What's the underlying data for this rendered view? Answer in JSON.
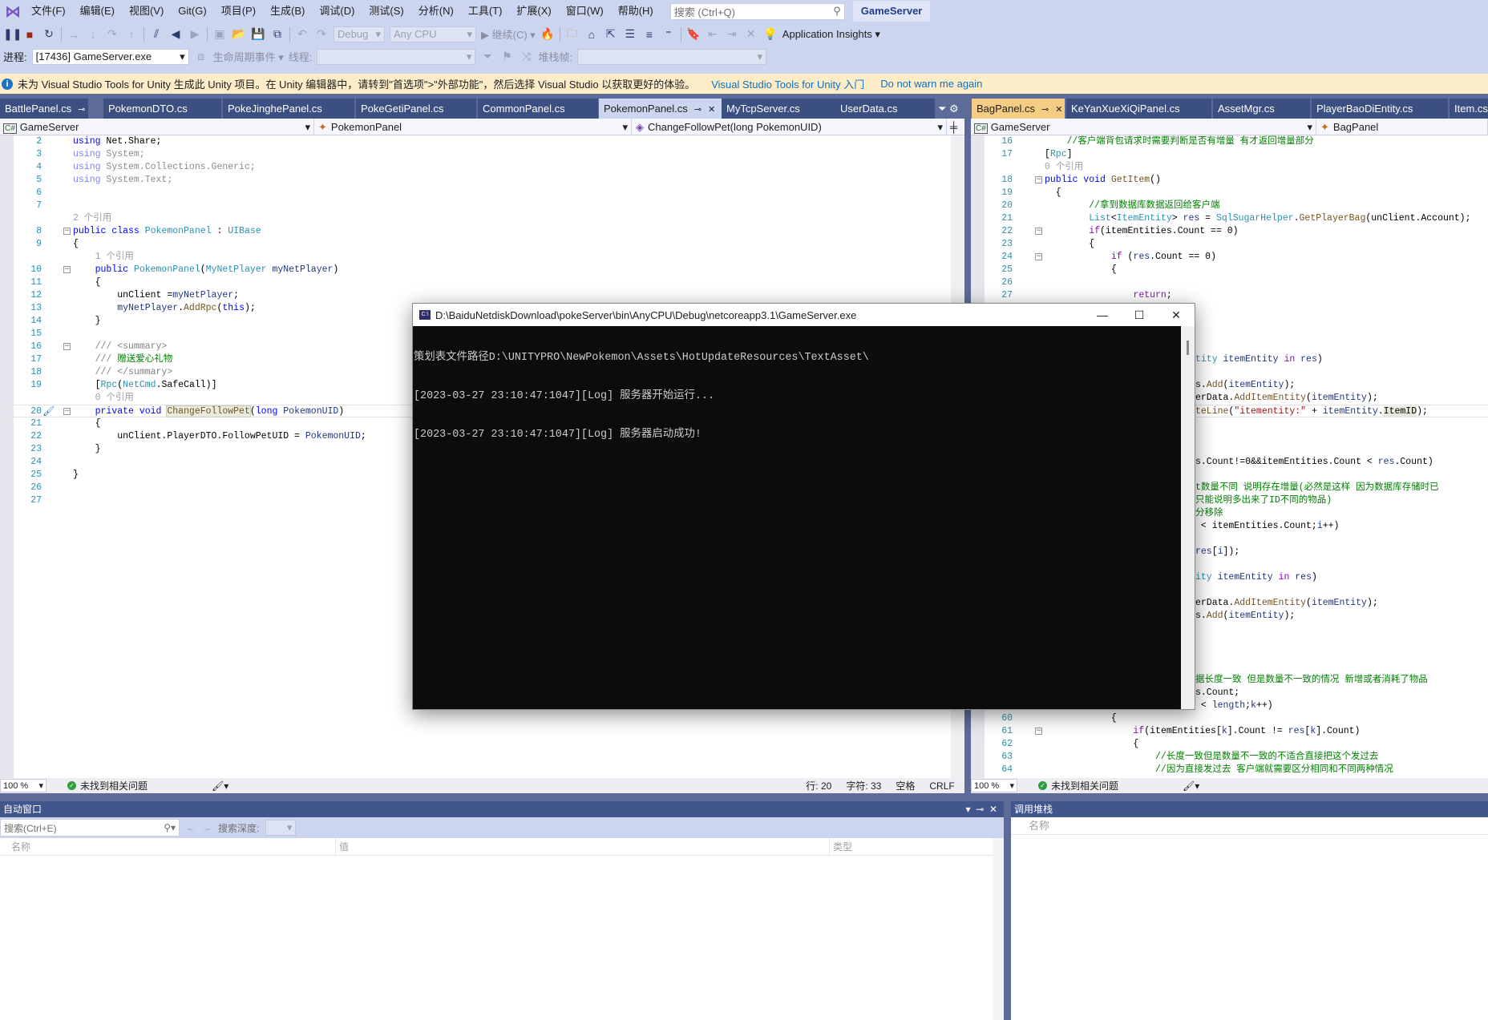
{
  "menu": [
    "文件(F)",
    "编辑(E)",
    "视图(V)",
    "Git(G)",
    "项目(P)",
    "生成(B)",
    "调试(D)",
    "测试(S)",
    "分析(N)",
    "工具(T)",
    "扩展(X)",
    "窗口(W)",
    "帮助(H)"
  ],
  "search": {
    "placeholder": "搜索 (Ctrl+Q)"
  },
  "solution_name": "GameServer",
  "toolbar1": {
    "config": "Debug",
    "platform": "Any CPU",
    "continue": "继续(C)",
    "insights": "Application Insights"
  },
  "toolbar2": {
    "process_label": "进程:",
    "process_value": "[17436] GameServer.exe",
    "lifecycle": "生命周期事件",
    "thread_label": "线程:",
    "stackframe_label": "堆栈帧:"
  },
  "infobar": {
    "message": "未为 Visual Studio Tools for Unity 生成此 Unity 项目。在 Unity 编辑器中，请转到\"首选项\">\"外部功能\"，然后选择 Visual Studio 以获取更好的体验。",
    "link1": "Visual Studio Tools for Unity 入门",
    "link2": "Do not warn me again"
  },
  "left_tabs": [
    "BattlePanel.cs",
    "PokemonDTO.cs",
    "PokeJinghePanel.cs",
    "PokeGetiPanel.cs",
    "CommonPanel.cs",
    "PokemonPanel.cs",
    "MyTcpServer.cs",
    "UserData.cs"
  ],
  "right_tabs": [
    "BagPanel.cs",
    "KeYanXueXiQiPanel.cs",
    "AssetMgr.cs",
    "PlayerBaoDiEntity.cs",
    "Item.cs"
  ],
  "left_nav": {
    "project": "GameServer",
    "class": "PokemonPanel",
    "member": "ChangeFollowPet(long PokemonUID)"
  },
  "right_nav": {
    "project": "GameServer",
    "class": "BagPanel"
  },
  "left_code": [
    {
      "n": "2",
      "t": [
        [
          "using",
          "kw"
        ],
        [
          " Net.Share;",
          "pl"
        ]
      ]
    },
    {
      "n": "3",
      "t": [
        [
          "using",
          "dimkw"
        ],
        [
          " System;",
          "dim"
        ]
      ]
    },
    {
      "n": "4",
      "t": [
        [
          "using",
          "dimkw"
        ],
        [
          " System.Collections.Generic;",
          "dim"
        ]
      ]
    },
    {
      "n": "5",
      "t": [
        [
          "using",
          "dimkw"
        ],
        [
          " System.Text;",
          "dim"
        ]
      ]
    },
    {
      "n": "6",
      "t": []
    },
    {
      "n": "7",
      "t": []
    },
    {
      "n": "",
      "t": [
        [
          "2 个引用",
          "lens"
        ]
      ]
    },
    {
      "n": "8",
      "fold": true,
      "t": [
        [
          "public class ",
          "kw"
        ],
        [
          "PokemonPanel",
          "ty"
        ],
        [
          " : ",
          "pl"
        ],
        [
          "UIBase",
          "ty"
        ]
      ]
    },
    {
      "n": "9",
      "t": [
        [
          "{",
          "pl"
        ]
      ]
    },
    {
      "n": "",
      "t": [
        [
          "    1 个引用",
          "lens"
        ]
      ]
    },
    {
      "n": "10",
      "fold": true,
      "t": [
        [
          "    public ",
          "kw"
        ],
        [
          "PokemonPanel",
          "ty"
        ],
        [
          "(",
          "pl"
        ],
        [
          "MyNetPlayer",
          "ty"
        ],
        [
          " myNetPlayer",
          "var"
        ],
        [
          ")",
          "pl"
        ]
      ]
    },
    {
      "n": "11",
      "t": [
        [
          "    {",
          "pl"
        ]
      ]
    },
    {
      "n": "12",
      "t": [
        [
          "        unClient =",
          "pl"
        ],
        [
          "myNetPlayer",
          "var"
        ],
        [
          ";",
          "pl"
        ]
      ]
    },
    {
      "n": "13",
      "t": [
        [
          "        myNetPlayer",
          "var"
        ],
        [
          ".",
          "pl"
        ],
        [
          "AddRpc",
          "fn"
        ],
        [
          "(",
          "pl"
        ],
        [
          "this",
          "kw"
        ],
        [
          ");",
          "pl"
        ]
      ]
    },
    {
      "n": "14",
      "t": [
        [
          "    }",
          "pl"
        ]
      ]
    },
    {
      "n": "15",
      "t": []
    },
    {
      "n": "16",
      "fold": true,
      "t": [
        [
          "    /// <summary>",
          "doc"
        ]
      ]
    },
    {
      "n": "17",
      "t": [
        [
          "    /// ",
          "doc"
        ],
        [
          "赠送爱心礼物",
          "cm"
        ]
      ]
    },
    {
      "n": "18",
      "t": [
        [
          "    /// </summary>",
          "doc"
        ]
      ]
    },
    {
      "n": "19",
      "t": [
        [
          "    [",
          "pl"
        ],
        [
          "Rpc",
          "ty"
        ],
        [
          "(",
          "pl"
        ],
        [
          "NetCmd",
          "ty"
        ],
        [
          ".SafeCall)]",
          "pl"
        ]
      ]
    },
    {
      "n": "",
      "t": [
        [
          "    0 个引用",
          "lens"
        ]
      ]
    },
    {
      "n": "20",
      "fold": true,
      "current": true,
      "t": [
        [
          "    private void ",
          "kw"
        ],
        [
          "ChangeFollowPet",
          "fn hl"
        ],
        [
          "(",
          "pl"
        ],
        [
          "long ",
          "kw"
        ],
        [
          "PokemonUID",
          "var"
        ],
        [
          ")",
          "pl"
        ]
      ]
    },
    {
      "n": "21",
      "t": [
        [
          "    {",
          "pl"
        ]
      ]
    },
    {
      "n": "22",
      "t": [
        [
          "        unClient.PlayerDTO.FollowPetUID = ",
          "pl"
        ],
        [
          "PokemonUID",
          "var"
        ],
        [
          ";",
          "pl"
        ]
      ]
    },
    {
      "n": "23",
      "t": [
        [
          "    }",
          "pl"
        ]
      ]
    },
    {
      "n": "24",
      "t": []
    },
    {
      "n": "25",
      "t": [
        [
          "}",
          "pl"
        ]
      ]
    },
    {
      "n": "26",
      "t": []
    },
    {
      "n": "27",
      "t": []
    }
  ],
  "right_code": [
    {
      "n": "16",
      "t": [
        [
          "    //客户端背包请求时需要判断是否有增量 有才返回增量部分",
          "cm"
        ]
      ]
    },
    {
      "n": "17",
      "t": [
        [
          "[",
          "pl"
        ],
        [
          "Rpc",
          "ty"
        ],
        [
          "]",
          "pl"
        ]
      ]
    },
    {
      "n": "",
      "t": [
        [
          "0 个引用",
          "lens"
        ]
      ]
    },
    {
      "n": "18",
      "fold": true,
      "t": [
        [
          "public void ",
          "kw"
        ],
        [
          "GetItem",
          "fn"
        ],
        [
          "()",
          "pl"
        ]
      ]
    },
    {
      "n": "19",
      "t": [
        [
          "  {",
          "pl"
        ]
      ]
    },
    {
      "n": "20",
      "t": [
        [
          "        //拿到数据库数据返回给客户端",
          "cm"
        ]
      ]
    },
    {
      "n": "21",
      "t": [
        [
          "        List",
          "ty"
        ],
        [
          "<",
          "pl"
        ],
        [
          "ItemEntity",
          "ty"
        ],
        [
          "> ",
          "pl"
        ],
        [
          "res",
          "var"
        ],
        [
          " = ",
          "pl"
        ],
        [
          "SqlSugarHelper",
          "ty"
        ],
        [
          ".",
          "pl"
        ],
        [
          "GetPlayerBag",
          "fn"
        ],
        [
          "(unClient.Account);",
          "pl"
        ]
      ]
    },
    {
      "n": "22",
      "fold": true,
      "t": [
        [
          "        if",
          "ctl"
        ],
        [
          "(itemEntities.Count == 0)",
          "pl"
        ]
      ]
    },
    {
      "n": "23",
      "t": [
        [
          "        {",
          "pl"
        ]
      ]
    },
    {
      "n": "24",
      "fold": true,
      "t": [
        [
          "            if",
          "ctl"
        ],
        [
          " (",
          "pl"
        ],
        [
          "res",
          "var"
        ],
        [
          ".Count == 0)",
          "pl"
        ]
      ]
    },
    {
      "n": "25",
      "t": [
        [
          "            {",
          "pl"
        ]
      ]
    },
    {
      "n": "26",
      "t": []
    },
    {
      "n": "27",
      "t": [
        [
          "                return",
          "ctl"
        ],
        [
          ";",
          "pl"
        ]
      ]
    },
    {
      "hidden": true
    },
    {
      "hidden": true
    },
    {
      "hidden": true
    },
    {
      "hidden": true
    },
    {
      "frag": [
        [
          "tity",
          "ty"
        ],
        [
          " itemEntity ",
          "var"
        ],
        [
          "in",
          "ctl"
        ],
        [
          " res",
          "var"
        ],
        [
          ")",
          "pl"
        ]
      ]
    },
    {
      "hidden": true
    },
    {
      "frag": [
        [
          "s.",
          "pl"
        ],
        [
          "Add",
          "fn"
        ],
        [
          "(",
          "pl"
        ],
        [
          "itemEntity",
          "var"
        ],
        [
          ");",
          "pl"
        ]
      ]
    },
    {
      "frag": [
        [
          "erData.",
          "pl"
        ],
        [
          "AddItemEntity",
          "fn"
        ],
        [
          "(",
          "pl"
        ],
        [
          "itemEntity",
          "var"
        ],
        [
          ");",
          "pl"
        ]
      ]
    },
    {
      "current": true,
      "frag": [
        [
          "teLine",
          "fn"
        ],
        [
          "(",
          "pl"
        ],
        [
          "\"itementity:\"",
          "str"
        ],
        [
          " + ",
          "pl"
        ],
        [
          "itemEntity",
          "var"
        ],
        [
          ".",
          "pl"
        ],
        [
          "ItemID",
          "pl hl2"
        ],
        [
          ");",
          "pl"
        ]
      ]
    },
    {
      "hidden": true
    },
    {
      "hidden": true
    },
    {
      "hidden": true
    },
    {
      "frag": [
        [
          "s.Count!=0&&itemEntities.Count < ",
          "pl"
        ],
        [
          "res",
          "var"
        ],
        [
          ".Count)",
          "pl"
        ]
      ]
    },
    {
      "hidden": true
    },
    {
      "frag": [
        [
          "t数量不同 说明存在增量(必然是这样 因为数据库存储时已",
          "cm"
        ]
      ]
    },
    {
      "frag": [
        [
          "只能说明多出来了ID不同的物品)",
          "cm"
        ]
      ]
    },
    {
      "frag": [
        [
          "分移除",
          "cm"
        ]
      ]
    },
    {
      "frag": [
        [
          " < itemEntities.Count;",
          "pl"
        ],
        [
          "i",
          "var"
        ],
        [
          "++)",
          "pl"
        ]
      ]
    },
    {
      "hidden": true
    },
    {
      "frag": [
        [
          "res",
          "var"
        ],
        [
          "[",
          "pl"
        ],
        [
          "i",
          "var"
        ],
        [
          "]);",
          "pl"
        ]
      ]
    },
    {
      "hidden": true
    },
    {
      "frag": [
        [
          "ity",
          "ty"
        ],
        [
          " itemEntity ",
          "var"
        ],
        [
          "in",
          "ctl"
        ],
        [
          " res",
          "var"
        ],
        [
          ")",
          "pl"
        ]
      ]
    },
    {
      "hidden": true
    },
    {
      "frag": [
        [
          "erData.",
          "pl"
        ],
        [
          "AddItemEntity",
          "fn"
        ],
        [
          "(",
          "pl"
        ],
        [
          "itemEntity",
          "var"
        ],
        [
          ");",
          "pl"
        ]
      ]
    },
    {
      "frag": [
        [
          "s.",
          "pl"
        ],
        [
          "Add",
          "fn"
        ],
        [
          "(",
          "pl"
        ],
        [
          "itemEntity",
          "var"
        ],
        [
          ");",
          "pl"
        ]
      ]
    },
    {
      "hidden": true
    },
    {
      "hidden": true
    },
    {
      "hidden": true
    },
    {
      "hidden": true
    },
    {
      "frag": [
        [
          "据长度一致 但是数量不一致的情况 新增或者消耗了物品",
          "cm"
        ]
      ]
    },
    {
      "frag": [
        [
          "s.Count;",
          "pl"
        ]
      ]
    },
    {
      "frag": [
        [
          " < ",
          "pl"
        ],
        [
          "length",
          "var"
        ],
        [
          ";",
          "pl"
        ],
        [
          "k",
          "var"
        ],
        [
          "++)",
          "pl"
        ]
      ]
    },
    {
      "n": "60",
      "t": [
        [
          "            {",
          "pl"
        ]
      ]
    },
    {
      "n": "61",
      "fold": true,
      "t": [
        [
          "                if",
          "ctl"
        ],
        [
          "(itemEntities[",
          "pl"
        ],
        [
          "k",
          "var"
        ],
        [
          "].Count != ",
          "pl"
        ],
        [
          "res",
          "var"
        ],
        [
          "[",
          "pl"
        ],
        [
          "k",
          "var"
        ],
        [
          "].Count)",
          "pl"
        ]
      ]
    },
    {
      "n": "62",
      "t": [
        [
          "                {",
          "pl"
        ]
      ]
    },
    {
      "n": "63",
      "t": [
        [
          "                    //长度一致但是数量不一致的不适合直接把这个发过去",
          "cm"
        ]
      ]
    },
    {
      "n": "64",
      "t": [
        [
          "                    //因为直接发过去 客户端就需要区分相同和不同两种情况",
          "cm"
        ]
      ]
    }
  ],
  "left_status": {
    "zoom": "100 %",
    "issues": "未找到相关问题",
    "line": "行: 20",
    "char": "字符: 33",
    "spaces": "空格",
    "eol": "CRLF"
  },
  "right_status": {
    "zoom": "100 %",
    "issues": "未找到相关问题"
  },
  "autos": {
    "title": "自动窗口",
    "search_placeholder": "搜索(Ctrl+E)",
    "depth_label": "搜索深度:",
    "columns": [
      "名称",
      "值",
      "类型"
    ]
  },
  "callstack": {
    "title": "调用堆栈",
    "columns": [
      "名称"
    ]
  },
  "console": {
    "title": "D:\\BaiduNetdiskDownload\\pokeServer\\bin\\AnyCPU\\Debug\\netcoreapp3.1\\GameServer.exe",
    "lines": [
      "策划表文件路径D:\\UNITYPRO\\NewPokemon\\Assets\\HotUpdateResources\\TextAsset\\",
      "[2023-03-27 23:10:47:1047][Log] 服务器开始运行...",
      "[2023-03-27 23:10:47:1047][Log] 服务器启动成功!"
    ]
  },
  "colors": {
    "accent": "#3b4f81",
    "toolbar_bg": "#ccd5f0",
    "active_tab_right": "#f5cc84",
    "infobar_bg": "#fdecc8",
    "console_bg": "#0c0c0c"
  }
}
